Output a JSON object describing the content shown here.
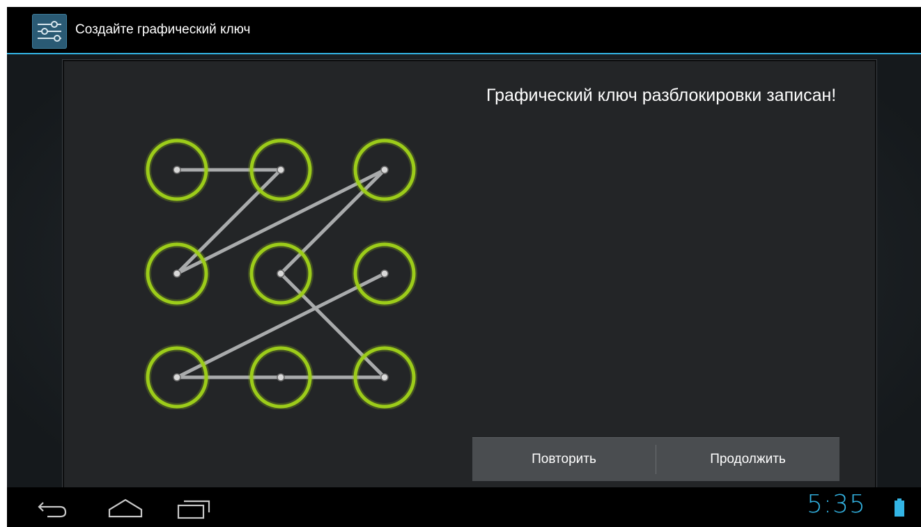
{
  "action_bar": {
    "title": "Создайте графический ключ",
    "icon": "settings-sliders-icon"
  },
  "main": {
    "header_text": "Графический ключ разблокировки записан!",
    "pattern": {
      "grid_size": 3,
      "sequence": [
        1,
        2,
        4,
        3,
        5,
        9,
        8,
        7,
        6
      ],
      "dot_color": "#9ccc1a",
      "line_color": "#a9abac"
    }
  },
  "buttons": {
    "retry_label": "Повторить",
    "continue_label": "Продолжить"
  },
  "nav_bar": {
    "back_icon": "back-icon",
    "home_icon": "home-icon",
    "recents_icon": "recent-apps-icon",
    "clock": "5:35",
    "battery_icon": "battery-icon"
  },
  "colors": {
    "accent": "#33b5e5",
    "pattern_ring": "#9ccc1a"
  }
}
